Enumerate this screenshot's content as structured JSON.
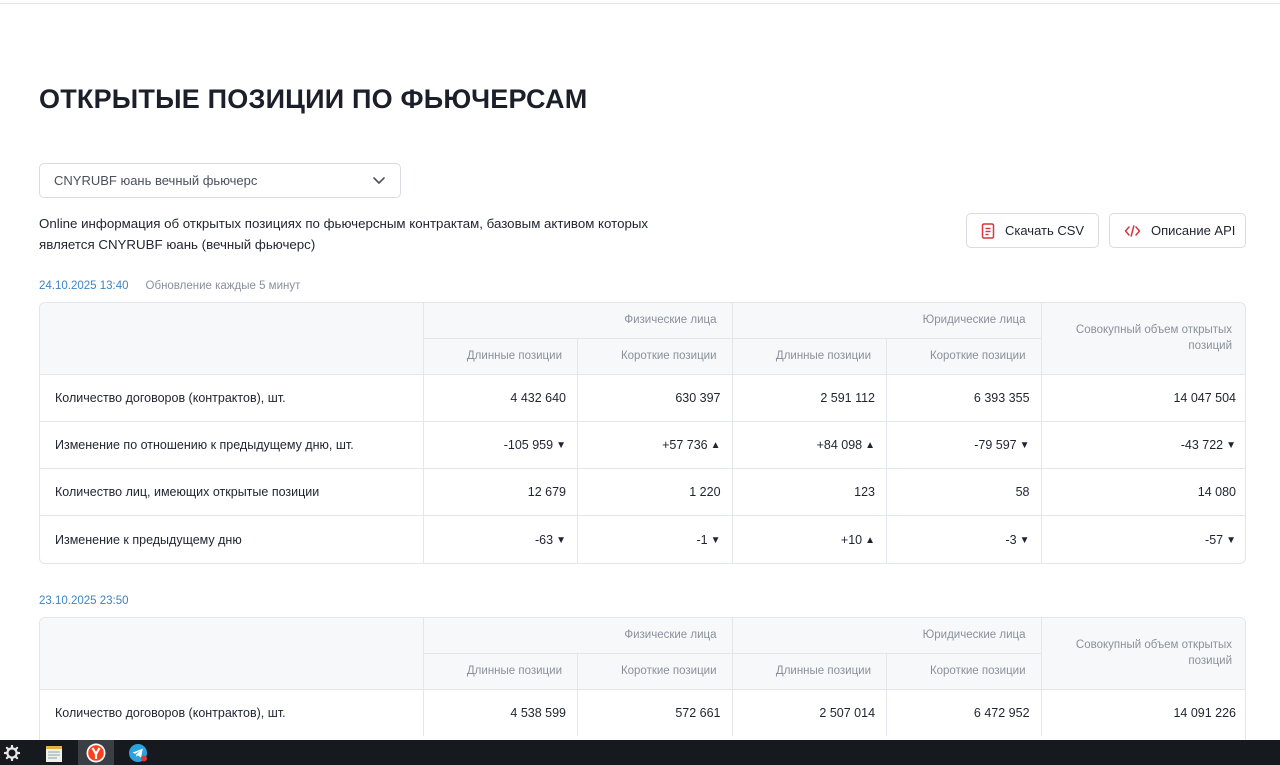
{
  "page": {
    "title": "ОТКРЫТЫЕ ПОЗИЦИИ ПО ФЬЮЧЕРСАМ",
    "select_value": "CNYRUBF юань вечный фьючерс",
    "description": "Online информация об открытых позициях по фьючерсным контрактам, базовым активом которых является CNYRUBF юань (вечный фьючерс)",
    "download_csv_label": "Скачать CSV",
    "api_label": "Описание API",
    "update_note": "Обновление каждые 5 минут"
  },
  "headers": {
    "physical": "Физические лица",
    "legal": "Юридические лица",
    "long": "Длинные позиции",
    "short": "Короткие позиции",
    "total": "Совокупный объем открытых позиций"
  },
  "colors": {
    "negative": "#e03636",
    "positive": "#3d9a42",
    "accent": "#3d83c4",
    "icon_red": "#d9343a"
  },
  "table1": {
    "timestamp": "24.10.2025 13:40",
    "rows": [
      {
        "label": "Количество договоров (контрактов), шт.",
        "cells": [
          {
            "v": "4 432 640",
            "t": ""
          },
          {
            "v": "630 397",
            "t": ""
          },
          {
            "v": "2 591 112",
            "t": ""
          },
          {
            "v": "6 393 355",
            "t": ""
          },
          {
            "v": "14 047 504",
            "t": ""
          }
        ]
      },
      {
        "label": "Изменение по отношению к предыдущему дню, шт.",
        "cells": [
          {
            "v": "-105 959",
            "t": "neg"
          },
          {
            "v": "+57 736",
            "t": "pos"
          },
          {
            "v": "+84 098",
            "t": "pos"
          },
          {
            "v": "-79 597",
            "t": "neg"
          },
          {
            "v": "-43 722",
            "t": "neg"
          }
        ]
      },
      {
        "label": "Количество лиц, имеющих открытые позиции",
        "cells": [
          {
            "v": "12 679",
            "t": ""
          },
          {
            "v": "1 220",
            "t": ""
          },
          {
            "v": "123",
            "t": ""
          },
          {
            "v": "58",
            "t": ""
          },
          {
            "v": "14 080",
            "t": ""
          }
        ]
      },
      {
        "label": "Изменение к предыдущему дню",
        "cells": [
          {
            "v": "-63",
            "t": "neg"
          },
          {
            "v": "-1",
            "t": "neg"
          },
          {
            "v": "+10",
            "t": "pos"
          },
          {
            "v": "-3",
            "t": "neg"
          },
          {
            "v": "-57",
            "t": "neg"
          }
        ]
      }
    ]
  },
  "table2": {
    "timestamp": "23.10.2025 23:50",
    "rows": [
      {
        "label": "Количество договоров (контрактов), шт.",
        "cells": [
          {
            "v": "4 538 599",
            "t": ""
          },
          {
            "v": "572 661",
            "t": ""
          },
          {
            "v": "2 507 014",
            "t": ""
          },
          {
            "v": "6 472 952",
            "t": ""
          },
          {
            "v": "14 091 226",
            "t": ""
          }
        ]
      }
    ]
  },
  "taskbar": {
    "items": [
      {
        "icon": "gear-icon"
      },
      {
        "icon": "notepad-icon"
      },
      {
        "icon": "yandex-browser-icon"
      },
      {
        "icon": "telegram-icon"
      }
    ]
  }
}
